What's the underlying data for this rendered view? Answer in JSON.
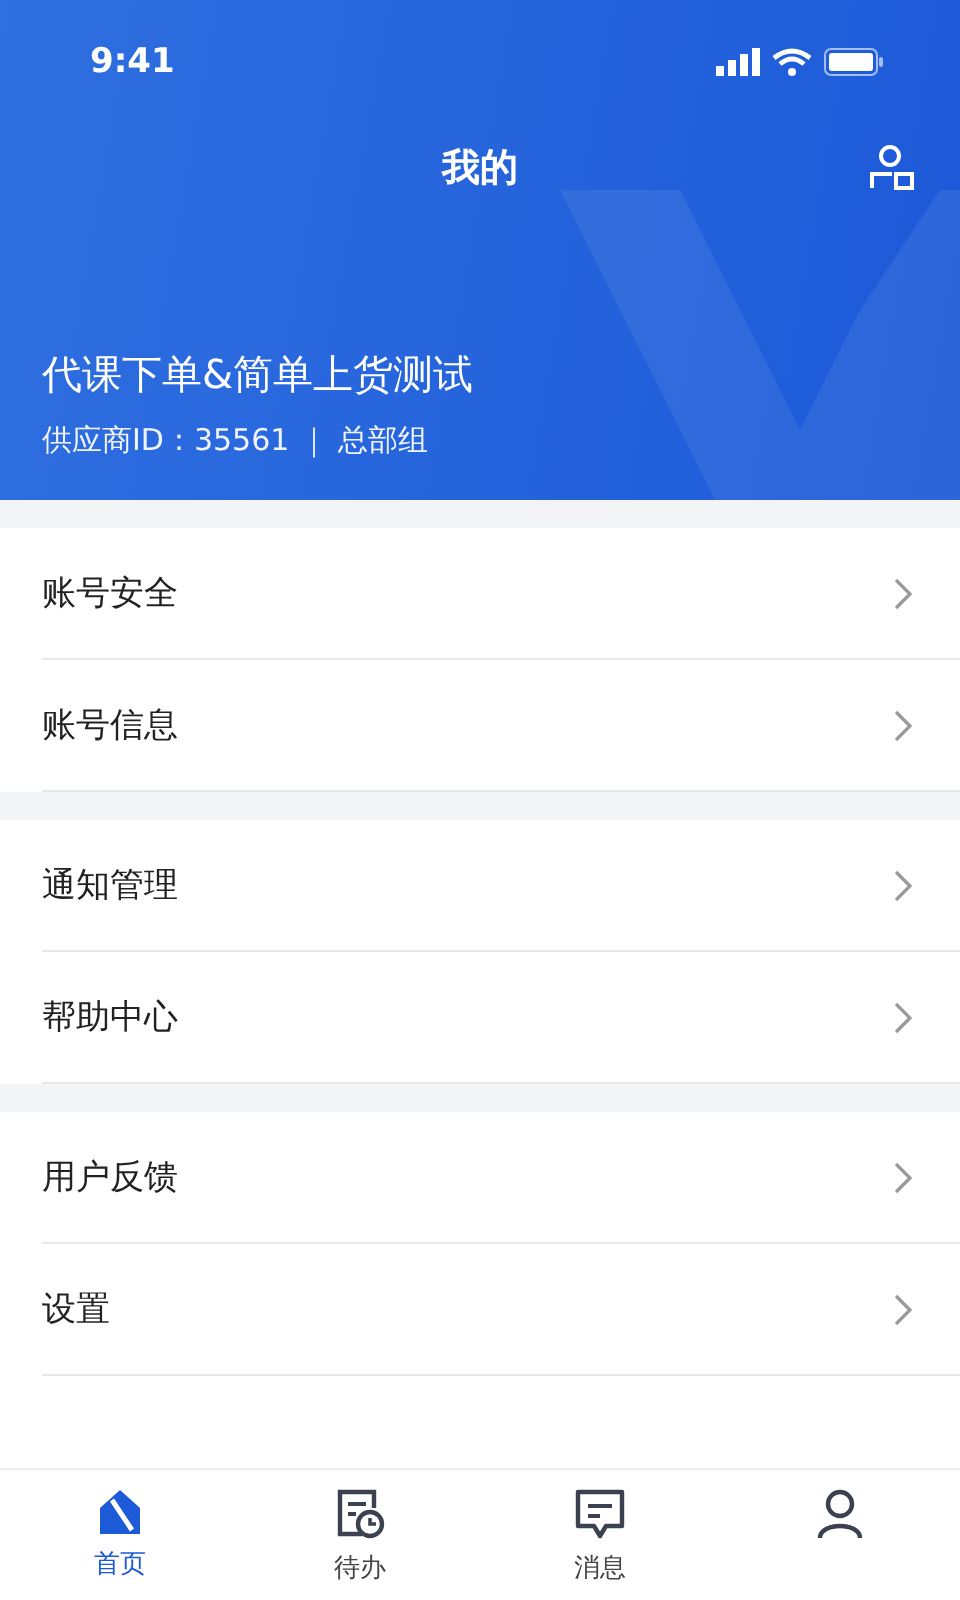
{
  "status_bar": {
    "time": "9:41"
  },
  "header": {
    "title": "我的",
    "company": "代课下单&简单上货测试",
    "meta": "供应商ID：35561 ｜ 总部组"
  },
  "menu_groups": [
    [
      {
        "label": "账号安全"
      },
      {
        "label": "账号信息"
      }
    ],
    [
      {
        "label": "通知管理"
      },
      {
        "label": "帮助中心"
      }
    ],
    [
      {
        "label": "用户反馈"
      },
      {
        "label": "设置"
      }
    ]
  ],
  "tabs": [
    {
      "kind": "home",
      "label": "首页",
      "selected": true
    },
    {
      "kind": "todo",
      "label": "待办",
      "selected": false
    },
    {
      "kind": "message",
      "label": "消息",
      "selected": false
    },
    {
      "kind": "profile",
      "selected": false
    }
  ]
}
